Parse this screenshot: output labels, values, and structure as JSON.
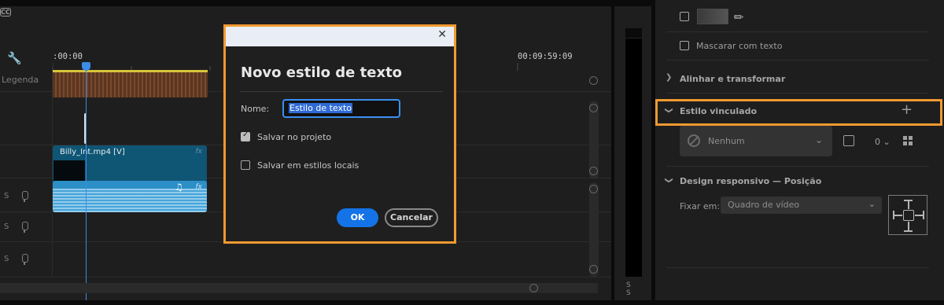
{
  "timeline": {
    "timecode_start": ":00:00",
    "timecode_end": "00:09:59:09",
    "caption_track_label": "Legenda",
    "video_clip_name": "Billy_Int.mp4 [V]",
    "fx_label": "fx",
    "audio_tracks": [
      {
        "solo": "S"
      },
      {
        "solo": "S"
      },
      {
        "solo": "S"
      }
    ],
    "work_area_color": "#d9c53a",
    "playhead_color": "#3d8ce8"
  },
  "meters": {
    "solo_labels": "S S"
  },
  "properties": {
    "mask_with_text_label": "Mascarar com texto",
    "align_transform_label": "Alinhar e transformar",
    "linked_style_label": "Estilo vinculado",
    "linked_style_value": "Nenhum",
    "linked_style_count": "0",
    "responsive_design_label": "Design responsivo — Posição",
    "pin_to_label": "Fixar em:",
    "pin_to_value": "Quadro de vídeo",
    "highlight_color": "#f29a31"
  },
  "dialog": {
    "title": "Novo estilo de texto",
    "name_label": "Nome:",
    "name_value": "Estilo de texto",
    "save_in_project_label": "Salvar no projeto",
    "save_in_project_checked": true,
    "save_local_label": "Salvar em estilos locais",
    "save_local_checked": false,
    "ok_label": "OK",
    "cancel_label": "Cancelar",
    "accent_color": "#1473e6"
  }
}
